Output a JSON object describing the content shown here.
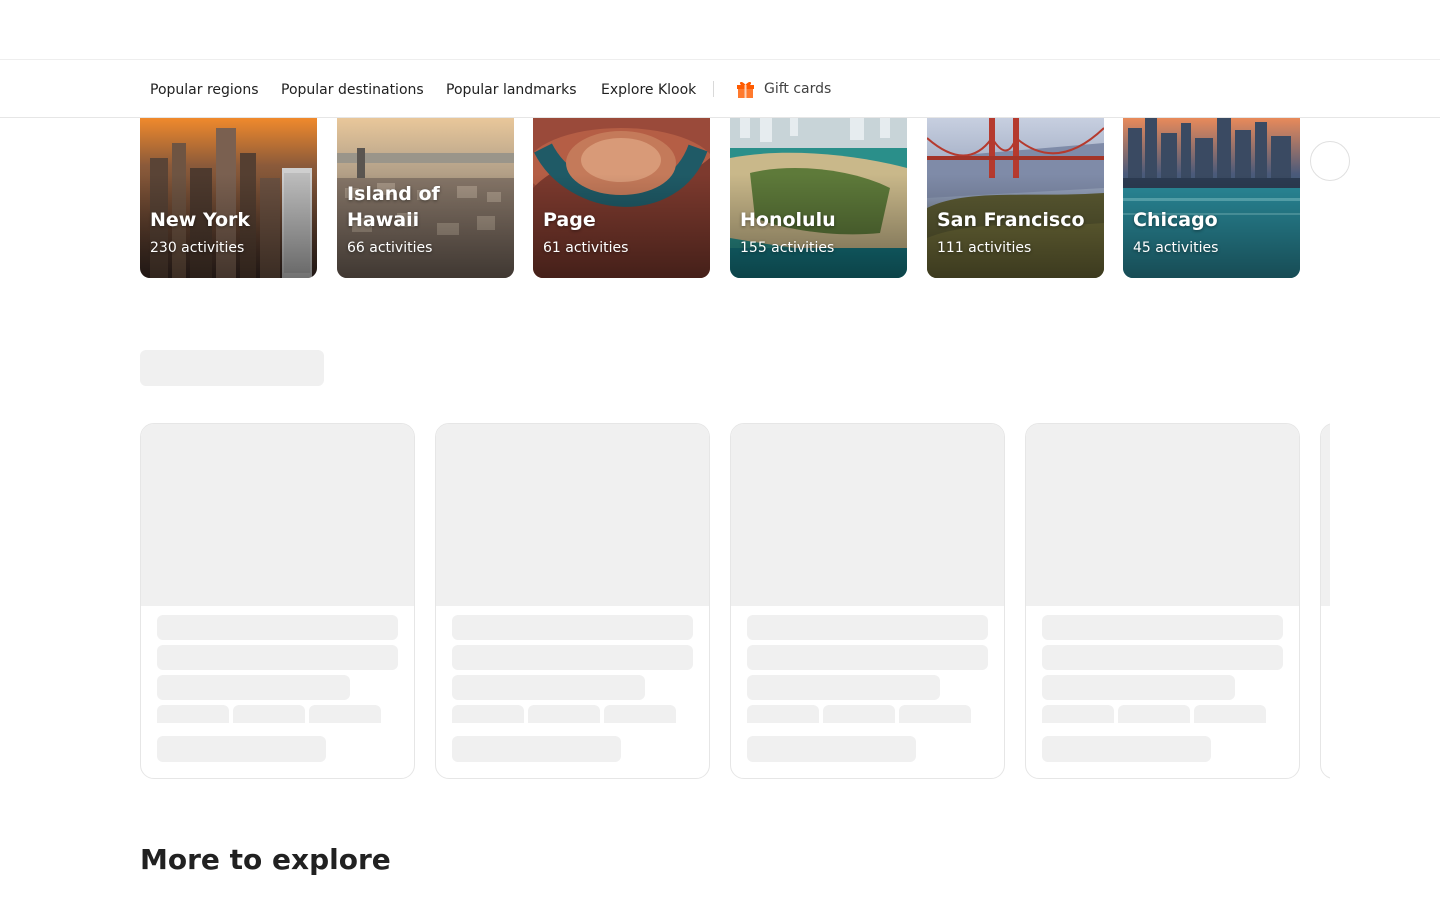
{
  "subnav": {
    "items": [
      {
        "label": "Popular regions"
      },
      {
        "label": "Popular destinations"
      },
      {
        "label": "Popular landmarks"
      },
      {
        "label": "Explore Klook"
      }
    ],
    "gift_label": "Gift cards",
    "gift_icon": "gift-icon",
    "gift_color": "#ff5b00"
  },
  "destinations": [
    {
      "name": "New York",
      "count": "230 activities"
    },
    {
      "name": "Island of Hawaii",
      "count": "66 activities"
    },
    {
      "name": "Page",
      "count": "61 activities"
    },
    {
      "name": "Honolulu",
      "count": "155 activities"
    },
    {
      "name": "San Francisco",
      "count": "111 activities"
    },
    {
      "name": "Chicago",
      "count": "45 activities"
    }
  ],
  "carousel": {
    "next_icon": "chevron-right-icon"
  },
  "section": {
    "title": "More to explore"
  }
}
